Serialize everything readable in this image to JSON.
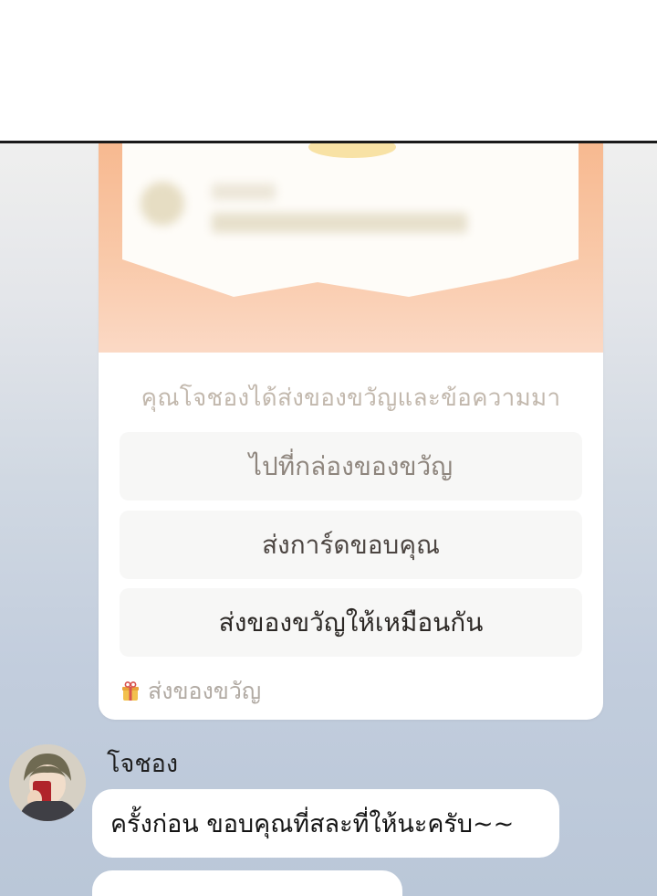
{
  "gift_card": {
    "message": "คุณโจชองได้ส่งของขวัญและข้อความมา",
    "buttons": {
      "go_to_gift_box": "ไปที่กล่องของขวัญ",
      "send_thank_card": "ส่งการ์ดขอบคุณ",
      "send_gift_back": "ส่งของขวัญให้เหมือนกัน"
    },
    "footer_label": "ส่งของขวัญ",
    "footer_icon": "gift-box-icon",
    "envelope_color": "#f7b990"
  },
  "chat": {
    "sender": "โจชอง",
    "message": "ครั้งก่อน ขอบคุณที่สละที่ให้นะครับ~~"
  }
}
